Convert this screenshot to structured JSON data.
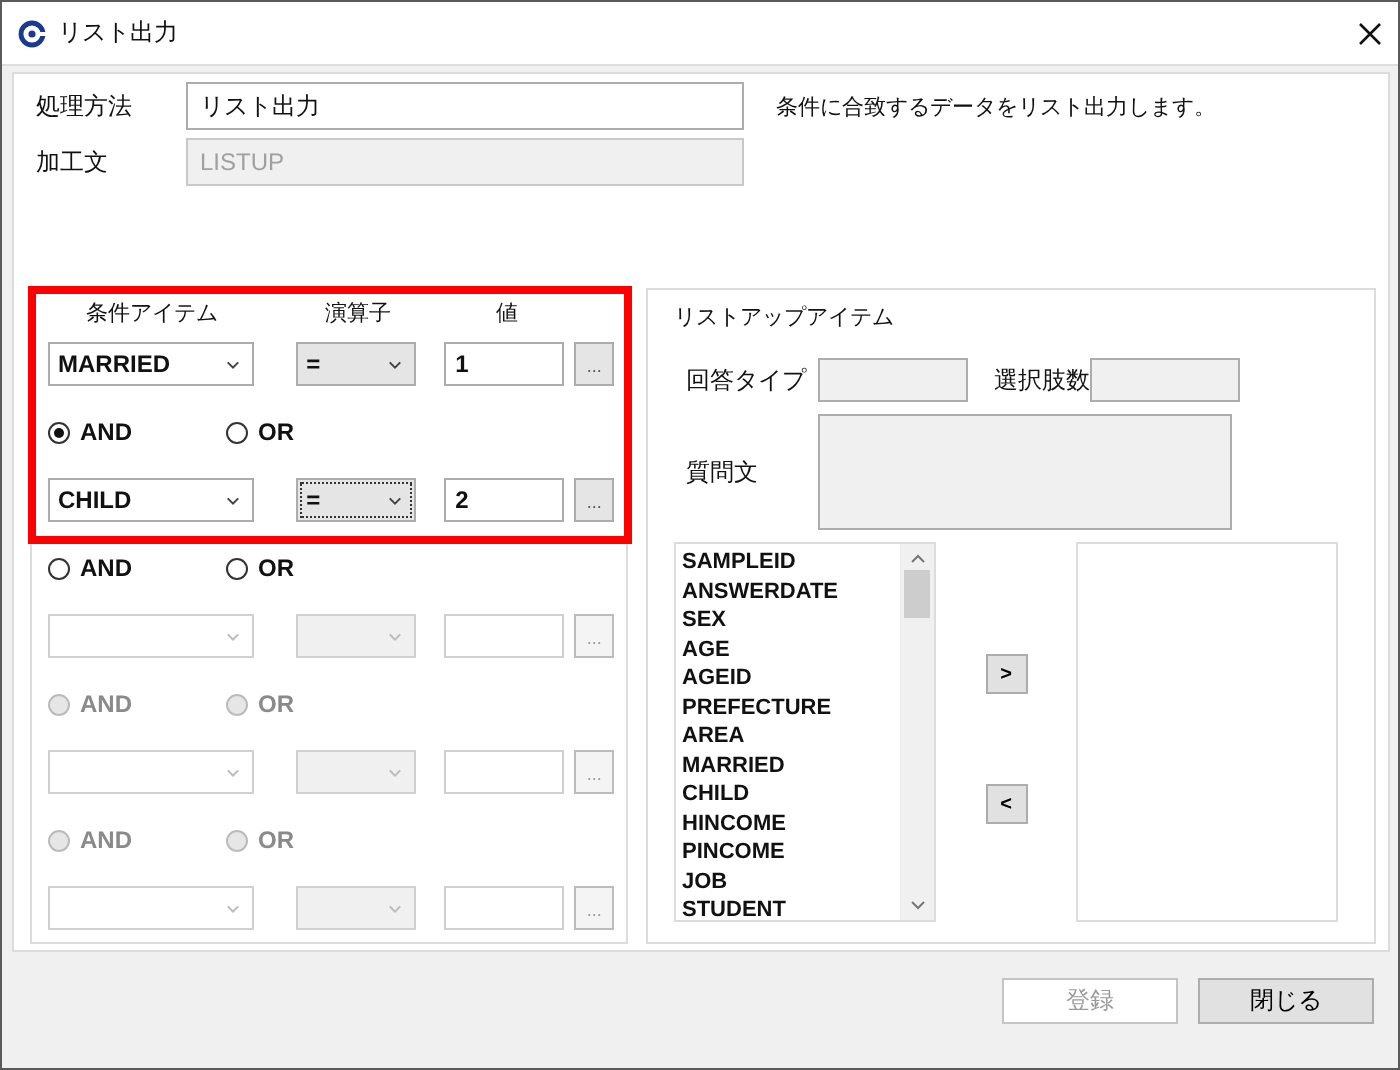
{
  "window": {
    "title": "リスト出力"
  },
  "form": {
    "method_label": "処理方法",
    "method_value": "リスト出力",
    "description": "条件に合致するデータをリスト出力します。",
    "process_label": "加工文",
    "process_value": "LISTUP",
    "process_disabled": true
  },
  "conditions": {
    "headers": [
      "条件アイテム",
      "演算子",
      "値"
    ],
    "rows": [
      {
        "kind": "condition",
        "item": "MARRIED",
        "operator": "=",
        "value": "1",
        "button": "...",
        "disabled": false,
        "focused": false,
        "highlighted": true
      },
      {
        "kind": "connector",
        "options": [
          {
            "label": "AND",
            "selected": true
          },
          {
            "label": "OR",
            "selected": false
          }
        ],
        "disabled": false,
        "highlighted": true
      },
      {
        "kind": "condition",
        "item": "CHILD",
        "operator": "=",
        "value": "2",
        "button": "...",
        "disabled": false,
        "focused": true,
        "highlighted": true
      },
      {
        "kind": "connector",
        "options": [
          {
            "label": "AND",
            "selected": false
          },
          {
            "label": "OR",
            "selected": false
          }
        ],
        "disabled": false
      },
      {
        "kind": "condition",
        "button": "...",
        "disabled": true,
        "focused": false
      },
      {
        "kind": "connector",
        "options": [
          {
            "label": "AND",
            "selected": false
          },
          {
            "label": "OR",
            "selected": false
          }
        ],
        "disabled": true
      },
      {
        "kind": "condition",
        "button": "...",
        "disabled": true,
        "focused": false
      },
      {
        "kind": "connector",
        "options": [
          {
            "label": "AND",
            "selected": false
          },
          {
            "label": "OR",
            "selected": false
          }
        ],
        "disabled": true
      },
      {
        "kind": "condition",
        "button": "...",
        "disabled": true,
        "focused": false
      }
    ]
  },
  "listup": {
    "title": "リストアップアイテム",
    "answer_type_label": "回答タイプ",
    "choices_label": "選択肢数",
    "question_label": "質問文",
    "available_items": [
      "SAMPLEID",
      "ANSWERDATE",
      "SEX",
      "AGE",
      "AGEID",
      "PREFECTURE",
      "AREA",
      "MARRIED",
      "CHILD",
      "HINCOME",
      "PINCOME",
      "JOB",
      "STUDENT"
    ],
    "add_button": ">",
    "remove_button": "<"
  },
  "buttons": [
    {
      "label": "登録",
      "disabled": true
    },
    {
      "label": "閉じる",
      "disabled": false
    }
  ]
}
